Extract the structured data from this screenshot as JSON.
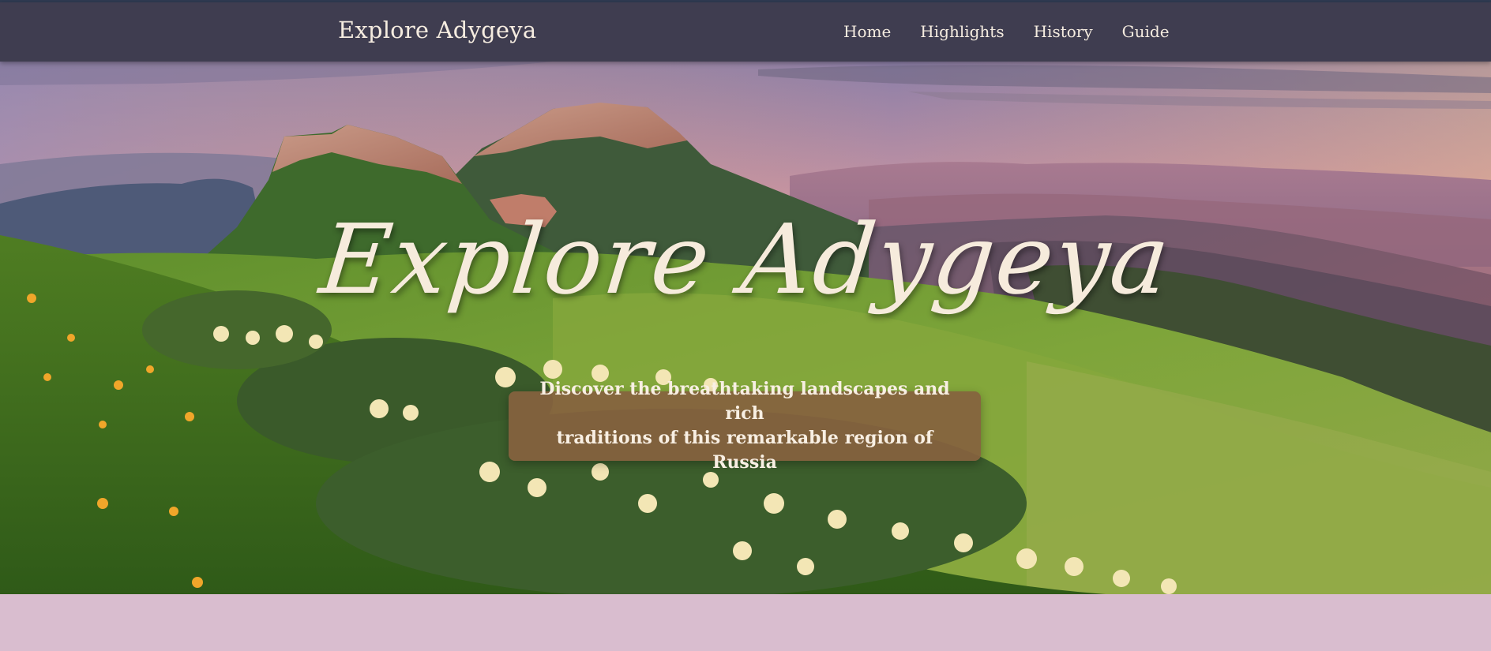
{
  "nav": {
    "brand": "Explore Adygeya",
    "links": [
      "Home",
      "Highlights",
      "History",
      "Guide"
    ]
  },
  "hero": {
    "title": "Explore Adygeya",
    "subtitle_line1": "Discover the breathtaking landscapes and rich",
    "subtitle_line2": "traditions of this remarkable region of Russia",
    "image": "mountain-landscape-with-flowers"
  },
  "colors": {
    "nav_bg": "#3f3d50",
    "nav_text": "#f5ece0",
    "subtitle_bg": "#85623e",
    "page_bg": "#d9bdcf"
  }
}
